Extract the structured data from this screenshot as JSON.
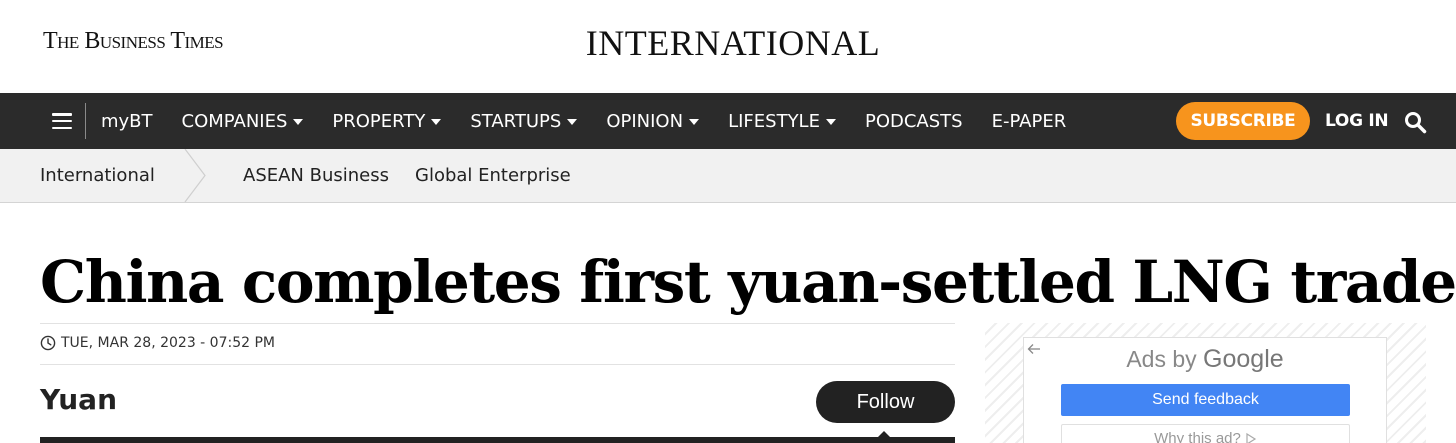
{
  "masthead": {
    "brand": "The Business Times",
    "section_title": "INTERNATIONAL"
  },
  "nav": {
    "mybt_label": "myBT",
    "items": [
      {
        "label": "COMPANIES",
        "dropdown": true
      },
      {
        "label": "PROPERTY",
        "dropdown": true
      },
      {
        "label": "STARTUPS",
        "dropdown": true
      },
      {
        "label": "OPINION",
        "dropdown": true
      },
      {
        "label": "LIFESTYLE",
        "dropdown": true
      },
      {
        "label": "PODCASTS",
        "dropdown": false
      },
      {
        "label": "E-PAPER",
        "dropdown": false
      }
    ],
    "subscribe_label": "SUBSCRIBE",
    "login_label": "LOG IN",
    "bar_color": "#2b2b2b",
    "subscribe_color": "#f7941d"
  },
  "subnav": {
    "current": "International",
    "links": [
      "ASEAN Business",
      "Global Enterprise"
    ]
  },
  "article": {
    "headline": "China completes first yuan-settled LNG trade",
    "dateline": "TUE, MAR 28, 2023 - 07:52 PM",
    "topic": "Yuan",
    "follow_label": "Follow"
  },
  "ad": {
    "ads_by": "Ads by",
    "google": "Google",
    "send_feedback": "Send feedback",
    "why_this_ad": "Why this ad?",
    "button_color": "#4285f4"
  },
  "icons": {
    "menu": "hamburger-menu-icon",
    "search": "search-icon",
    "clock": "clock-icon",
    "back": "back-arrow-icon",
    "ad_choices": "ad-choices-icon"
  }
}
